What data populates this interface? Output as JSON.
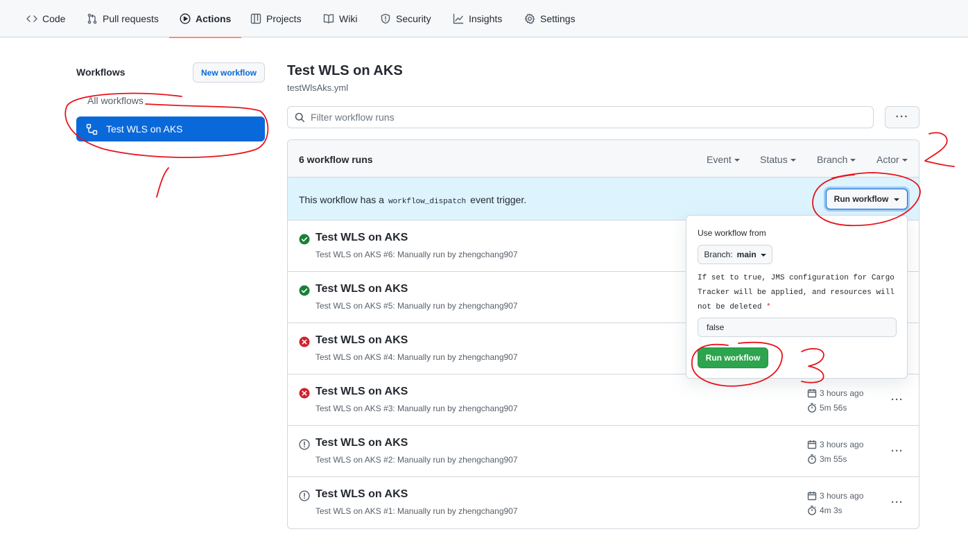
{
  "nav": {
    "tabs": [
      {
        "label": "Code",
        "icon": "code-icon"
      },
      {
        "label": "Pull requests",
        "icon": "pull-request-icon"
      },
      {
        "label": "Actions",
        "icon": "play-icon",
        "active": true
      },
      {
        "label": "Projects",
        "icon": "table-icon"
      },
      {
        "label": "Wiki",
        "icon": "book-icon"
      },
      {
        "label": "Security",
        "icon": "shield-icon"
      },
      {
        "label": "Insights",
        "icon": "graph-icon"
      },
      {
        "label": "Settings",
        "icon": "gear-icon"
      }
    ]
  },
  "sidebar": {
    "title": "Workflows",
    "new_workflow": "New workflow",
    "all_workflows": "All workflows",
    "selected_workflow": "Test WLS on AKS"
  },
  "header": {
    "title": "Test WLS on AKS",
    "file": "testWlsAks.yml",
    "filter_placeholder": "Filter workflow runs",
    "more": "···"
  },
  "runs": {
    "count_label": "6 workflow runs",
    "filters": [
      "Event",
      "Status",
      "Branch",
      "Actor"
    ],
    "dispatch_prefix": "This workflow has a",
    "dispatch_code": "workflow_dispatch",
    "dispatch_suffix": "event trigger.",
    "run_workflow_button": "Run workflow",
    "items": [
      {
        "title": "Test WLS on AKS",
        "subtitle": "Test WLS on AKS #6: Manually run by zhengchang907",
        "status": "success",
        "time": "",
        "duration": ""
      },
      {
        "title": "Test WLS on AKS",
        "subtitle": "Test WLS on AKS #5: Manually run by zhengchang907",
        "status": "success",
        "time": "",
        "duration": ""
      },
      {
        "title": "Test WLS on AKS",
        "subtitle": "Test WLS on AKS #4: Manually run by zhengchang907",
        "status": "failure",
        "time": "",
        "duration": ""
      },
      {
        "title": "Test WLS on AKS",
        "subtitle": "Test WLS on AKS #3: Manually run by zhengchang907",
        "status": "failure",
        "time": "3 hours ago",
        "duration": "5m 56s"
      },
      {
        "title": "Test WLS on AKS",
        "subtitle": "Test WLS on AKS #2: Manually run by zhengchang907",
        "status": "cancelled",
        "time": "3 hours ago",
        "duration": "3m 55s"
      },
      {
        "title": "Test WLS on AKS",
        "subtitle": "Test WLS on AKS #1: Manually run by zhengchang907",
        "status": "cancelled",
        "time": "3 hours ago",
        "duration": "4m 3s"
      }
    ]
  },
  "popover": {
    "label": "Use workflow from",
    "branch_prefix": "Branch:",
    "branch_name": "main",
    "input_description": "If set to true, JMS configuration for Cargo Tracker will be applied, and resources will not be deleted",
    "required_mark": "*",
    "input_value": "false",
    "submit": "Run workflow"
  },
  "colors": {
    "accent": "#0969da",
    "success": "#1a7f37",
    "failure": "#cf222e",
    "neutral": "#57606a",
    "run_button": "#2da44e",
    "annotation": "#e8131a"
  }
}
